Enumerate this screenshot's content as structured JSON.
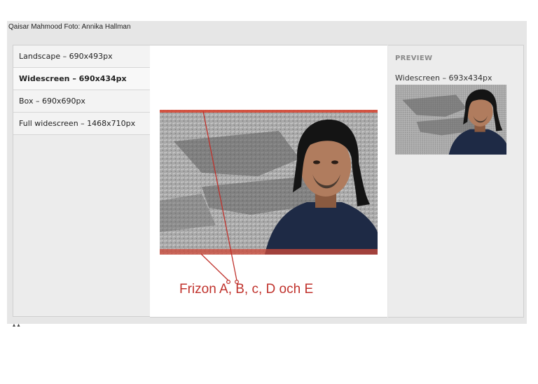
{
  "header": {
    "caption": "Qaisar Mahmood Foto: Annika Hallman"
  },
  "sidebar": {
    "items": [
      {
        "label": "Landscape – 690x493px",
        "active": false
      },
      {
        "label": "Widescreen – 690x434px",
        "active": true
      },
      {
        "label": "Box – 690x690px",
        "active": false
      },
      {
        "label": "Full widescreen – 1468x710px",
        "active": false
      }
    ]
  },
  "stage": {
    "annotation": "Frizon A, B, c, D och E"
  },
  "preview": {
    "heading": "PREVIEW",
    "size_label": "Widescreen – 693x434px"
  },
  "footer": {
    "crumb": "▴  ▴"
  },
  "colors": {
    "accent_red": "#c0322c",
    "crop_band": "#d8432f",
    "panel_bg": "#ececec"
  }
}
